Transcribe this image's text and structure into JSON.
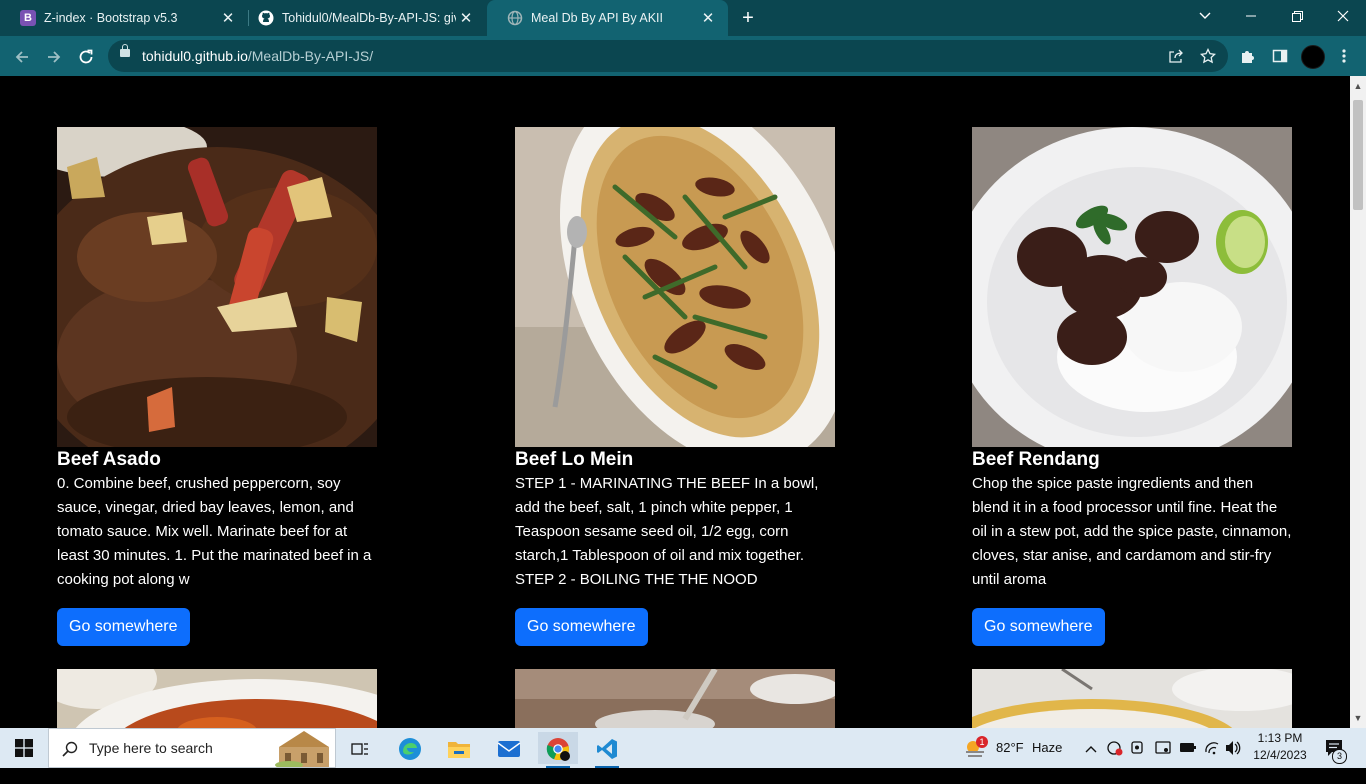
{
  "browser": {
    "tabs": [
      {
        "title": "Z-index · Bootstrap v5.3",
        "favicon": "B",
        "favicon_color": "#7952b3",
        "active": false
      },
      {
        "title": "Tohidul0/MealDb-By-API-JS: giv",
        "favicon": "github-icon",
        "favicon_color": "#ffffff",
        "active": false
      },
      {
        "title": "Meal Db By API By AKII",
        "favicon": "globe-icon",
        "favicon_color": "#9fb5b8",
        "active": true
      }
    ],
    "close_glyph": "✕",
    "new_tab_glyph": "+",
    "url_host": "tohidul0.github.io",
    "url_path": "/MealDb-By-API-JS/",
    "theme_color": "#126371"
  },
  "meals": [
    {
      "title": "Beef Asado",
      "description": "0. Combine beef, crushed peppercorn, soy sauce, vinegar, dried bay leaves, lemon, and tomato sauce. Mix well. Marinate beef for at least 30 minutes. 1. Put the marinated beef in a cooking pot along w",
      "button": "Go somewhere"
    },
    {
      "title": "Beef Lo Mein",
      "description": "STEP 1 - MARINATING THE BEEF In a bowl, add the beef, salt, 1 pinch white pepper, 1 Teaspoon sesame seed oil, 1/2 egg, corn starch,1 Tablespoon of oil and mix together. STEP 2 - BOILING THE THE NOOD",
      "button": "Go somewhere"
    },
    {
      "title": "Beef Rendang",
      "description": "Chop the spice paste ingredients and then blend it in a food processor until fine. Heat the oil in a stew pot, add the spice paste, cinnamon, cloves, star anise, and cardamom and stir-fry until aroma",
      "button": "Go somewhere"
    }
  ],
  "button_color": "#0d6efd",
  "taskbar": {
    "search_placeholder": "Type here to search",
    "weather_temp": "82°F",
    "weather_cond": "Haze",
    "weather_badge": "1",
    "time": "1:13 PM",
    "date": "12/4/2023",
    "notification_count": "3"
  }
}
